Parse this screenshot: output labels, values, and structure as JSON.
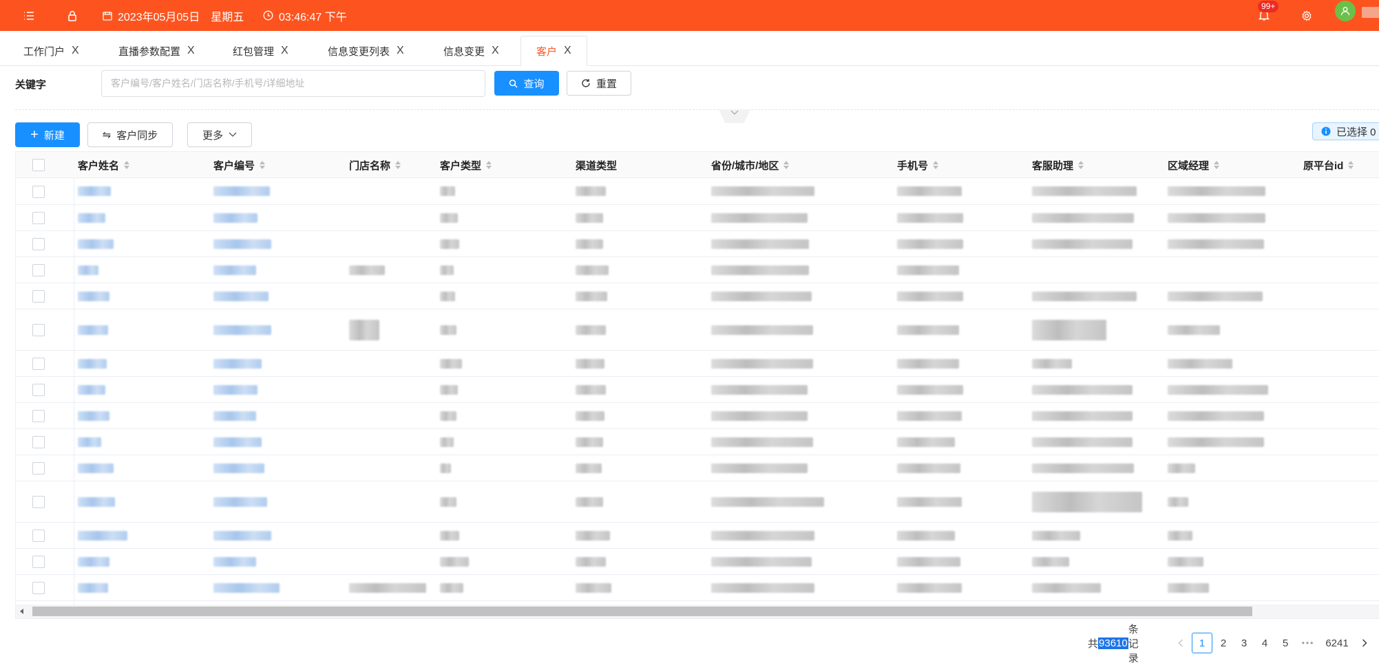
{
  "topbar": {
    "date": "2023年05月05日",
    "weekday": "星期五",
    "time": "03:46:47 下午",
    "notification_count": "99+",
    "accent_color": "#fd541f"
  },
  "tabs": [
    {
      "label": "工作门户",
      "close": "X"
    },
    {
      "label": "直播参数配置",
      "close": "X"
    },
    {
      "label": "红包管理",
      "close": "X"
    },
    {
      "label": "信息变更列表",
      "close": "X"
    },
    {
      "label": "信息变更",
      "close": "X"
    },
    {
      "label": "客户",
      "close": "X",
      "active": true
    }
  ],
  "search": {
    "label": "关键字",
    "placeholder": "客户编号/客户姓名/门店名称/手机号/详细地址",
    "query_button": "查询",
    "reset_button": "重置"
  },
  "toolbar": {
    "new_button": "新建",
    "sync_button": "客户同步",
    "more_button": "更多",
    "selected_info": "已选择 0"
  },
  "table": {
    "columns": [
      "客户姓名",
      "客户编号",
      "门店名称",
      "客户类型",
      "渠道类型",
      "省份/城市/地区",
      "手机号",
      "客服助理",
      "区域经理",
      "原平台id"
    ],
    "row_count_visible": 16,
    "cell_content": "blurred"
  },
  "pagination": {
    "total_prefix": "共",
    "total": "93610",
    "total_suffix": "条记录",
    "pages": [
      "1",
      "2",
      "3",
      "4",
      "5"
    ],
    "ellipsis": "•••",
    "last_page": "6241",
    "current_page": "1"
  }
}
